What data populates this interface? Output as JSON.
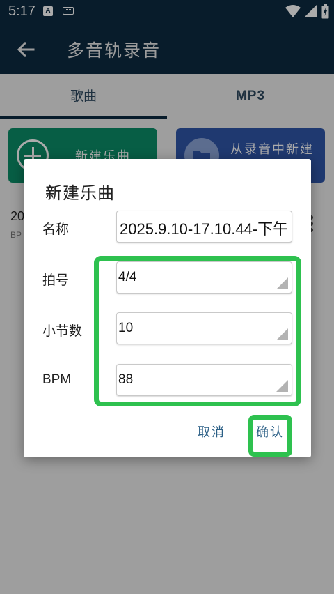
{
  "status_bar": {
    "time": "5:17",
    "notification_badge": "A",
    "icons": [
      "a-notification-icon",
      "keyboard-icon",
      "wifi-icon",
      "signal-icon",
      "battery-icon"
    ]
  },
  "app_bar": {
    "title": "多音轨录音",
    "back_icon": "back-arrow-icon"
  },
  "tabs": [
    {
      "label": "歌曲",
      "selected": true
    },
    {
      "label": "MP3",
      "selected": false
    }
  ],
  "actions": {
    "new_song_label": "新建乐曲",
    "from_recording_label": "从录音中新建"
  },
  "list": {
    "item_title_partial": "20",
    "item_sub_partial": "BP"
  },
  "dialog": {
    "title": "新建乐曲",
    "fields": {
      "name_label": "名称",
      "name_value": "2025.9.10-17.10.44-下午",
      "meter_label": "拍号",
      "meter_value": "4/4",
      "bars_label": "小节数",
      "bars_value": "10",
      "bpm_label": "BPM",
      "bpm_value": "88"
    },
    "cancel_label": "取消",
    "confirm_label": "确认"
  },
  "colors": {
    "app_bar": "#0d2a40",
    "new_song_button": "#0b8d67",
    "from_recording_button": "#2f55a8",
    "dialog_action_text": "#2b5f86",
    "highlight_outline": "#2ec14f"
  }
}
